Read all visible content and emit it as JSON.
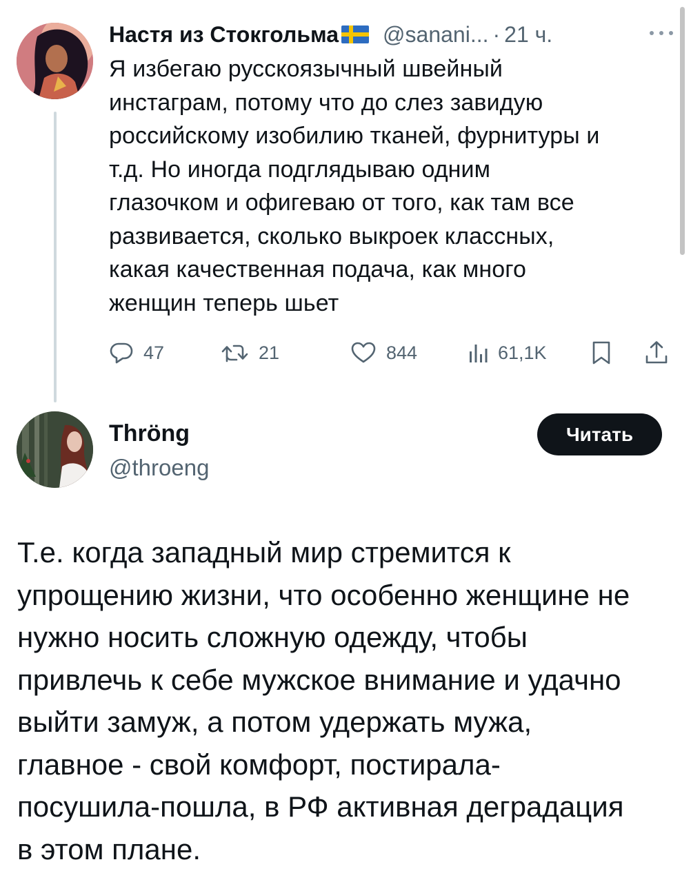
{
  "tweet1": {
    "author_name": "Настя из Стокгольма",
    "author_flag": "swedish-flag",
    "author_handle": "@sanani...",
    "separator": "·",
    "time": "21 ч.",
    "text_lines": [
      "Я избегаю русскоязычный швейный",
      "инстаграм, потому что до слез завидую",
      "российскому изобилию тканей, фурнитуры и",
      "т.д. Но иногда подглядываю одним",
      "глазочком и офигеваю от того, как там все",
      "развивается, сколько выкроек классных,",
      "какая качественная подача, как много",
      "женщин теперь шьет"
    ],
    "stats": {
      "replies": "47",
      "retweets": "21",
      "likes": "844",
      "views": "61,1K"
    }
  },
  "tweet2": {
    "author_name": "Thröng",
    "author_handle": "@throeng",
    "follow_label": "Читать",
    "text_lines": [
      "Т.е. когда западный мир стремится к",
      "упрощению жизни, что особенно женщине не",
      "нужно носить сложную одежду, чтобы",
      "привлечь к себе мужское внимание и удачно",
      "выйти замуж, а потом удержать мужа,",
      "главное - свой комфорт, постирала-",
      "посушила-пошла, в РФ активная деградация",
      "в этом плане."
    ]
  },
  "colors": {
    "text_primary": "#0f1419",
    "text_secondary": "#536471",
    "thread_line": "#cfd9de",
    "button_bg": "#0f1419"
  },
  "icons": {
    "reply": "reply-icon",
    "retweet": "retweet-icon",
    "like": "heart-icon",
    "views": "views-bar-chart-icon",
    "bookmark": "bookmark-icon",
    "share": "share-icon",
    "more": "more-dots-icon"
  }
}
